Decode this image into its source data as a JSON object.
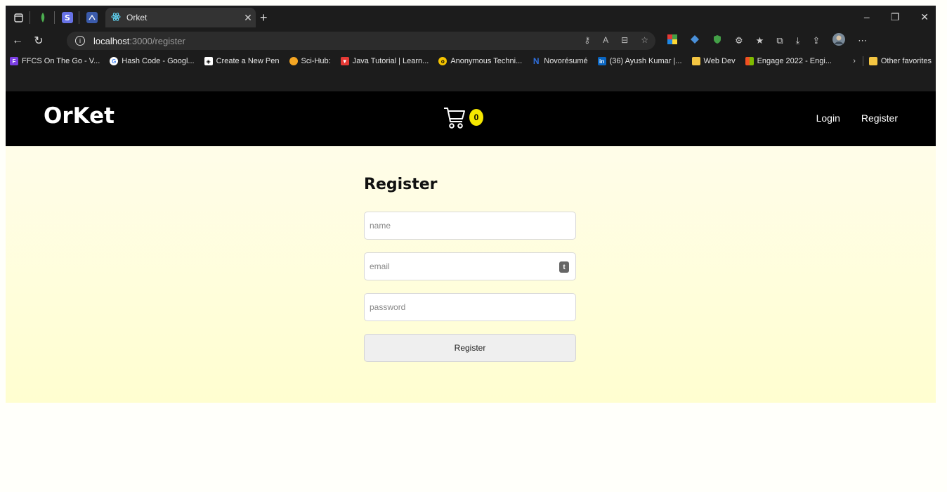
{
  "browser": {
    "tab_title": "Orket",
    "address": {
      "host": "localhost",
      "path": ":3000/register"
    },
    "bookmarks": [
      {
        "label": "FFCS On The Go - V...",
        "icon": "ffcs-icon",
        "color": "#7b3fe4"
      },
      {
        "label": "Hash Code - Googl...",
        "icon": "google-icon",
        "color": "#4285f4"
      },
      {
        "label": "Create a New Pen",
        "icon": "codepen-icon",
        "color": "#ffffff"
      },
      {
        "label": "Sci-Hub:",
        "icon": "scihub-icon",
        "color": "#f5a623"
      },
      {
        "label": "Java Tutorial | Learn...",
        "icon": "java-icon",
        "color": "#e53935"
      },
      {
        "label": "Anonymous Techni...",
        "icon": "anonymous-icon",
        "color": "#f5c400"
      },
      {
        "label": "Novorésumé",
        "icon": "novoresume-icon",
        "color": "#2f6fde"
      },
      {
        "label": "(36) Ayush Kumar |...",
        "icon": "linkedin-icon",
        "color": "#0a66c2"
      },
      {
        "label": "Web Dev",
        "icon": "folder-icon",
        "color": "#f4c542"
      },
      {
        "label": "Engage 2022 - Engi...",
        "icon": "microsoft-icon",
        "color": "#f25022"
      }
    ],
    "other_favorites": "Other favorites"
  },
  "app": {
    "brand": "OrKet",
    "cart_count": "0",
    "nav": {
      "login": "Login",
      "register": "Register"
    },
    "form": {
      "title": "Register",
      "name_placeholder": "name",
      "email_placeholder": "email",
      "password_placeholder": "password",
      "submit_label": "Register",
      "email_badge": "t"
    }
  },
  "colors": {
    "cart_badge": "#f5e700",
    "navbar": "#000000",
    "hero_top": "#fffde9",
    "hero_bottom": "#fffed0"
  }
}
